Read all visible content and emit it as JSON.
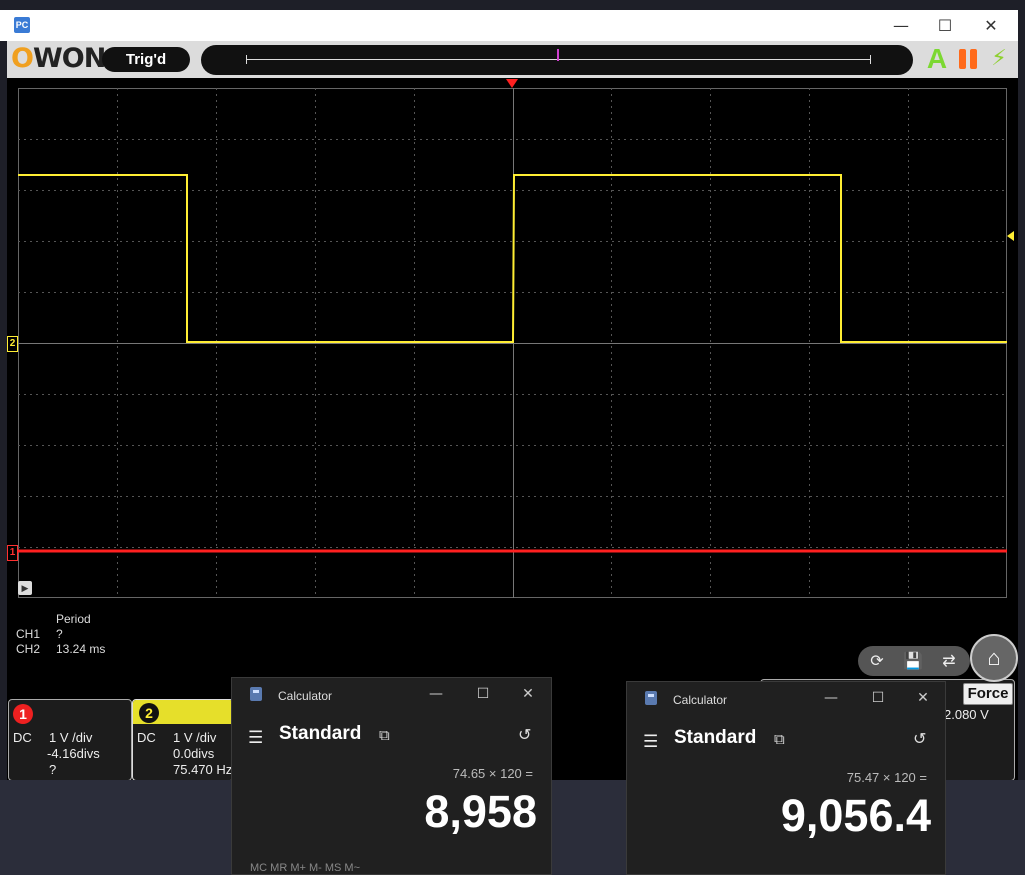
{
  "window": {
    "app_icon_text": "PC",
    "controls": {
      "minimize": "—",
      "maximize": "☐",
      "close": "✕"
    }
  },
  "toolbar": {
    "logo_o": "O",
    "logo_rest": "WON",
    "trigger_status": "Trig'd",
    "auto_label": "A",
    "run_icon": "⚡"
  },
  "scope": {
    "ch2_marker": "2",
    "ch1_marker": "1",
    "play_icon": "▶",
    "colors": {
      "ch1": "#ff2020",
      "ch2": "#ffee33",
      "grid": "#555555"
    }
  },
  "measurements": {
    "header": "Period",
    "rows": [
      {
        "channel": "CH1",
        "value": "?"
      },
      {
        "channel": "CH2",
        "value": "13.24 ms"
      }
    ]
  },
  "channels": {
    "ch1": {
      "num": "1",
      "coupling": "DC",
      "scale": "1 V /div",
      "offset": "-4.16divs",
      "freq": "?"
    },
    "ch2": {
      "num": "2",
      "coupling": "DC",
      "scale": "1 V /div",
      "offset": "0.0divs",
      "freq": "75.470 Hz"
    }
  },
  "trigger": {
    "force_label": "Force",
    "level": "2.080 V"
  },
  "icons": {
    "autoset": "⟳",
    "save": "💾",
    "swap": "⇄",
    "home": "⌂"
  },
  "calc1": {
    "title": "Calculator",
    "mode": "Standard",
    "menu_icon": "☰",
    "keep_icon": "⧉",
    "history_icon": "↺",
    "expression": "74.65 × 120 =",
    "result": "8,958",
    "memory": "MC    MR    M+    M-    MS    M~"
  },
  "calc2": {
    "title": "Calculator",
    "mode": "Standard",
    "menu_icon": "☰",
    "keep_icon": "⧉",
    "history_icon": "↺",
    "expression": "75.47 × 120 =",
    "result": "9,056.4"
  }
}
